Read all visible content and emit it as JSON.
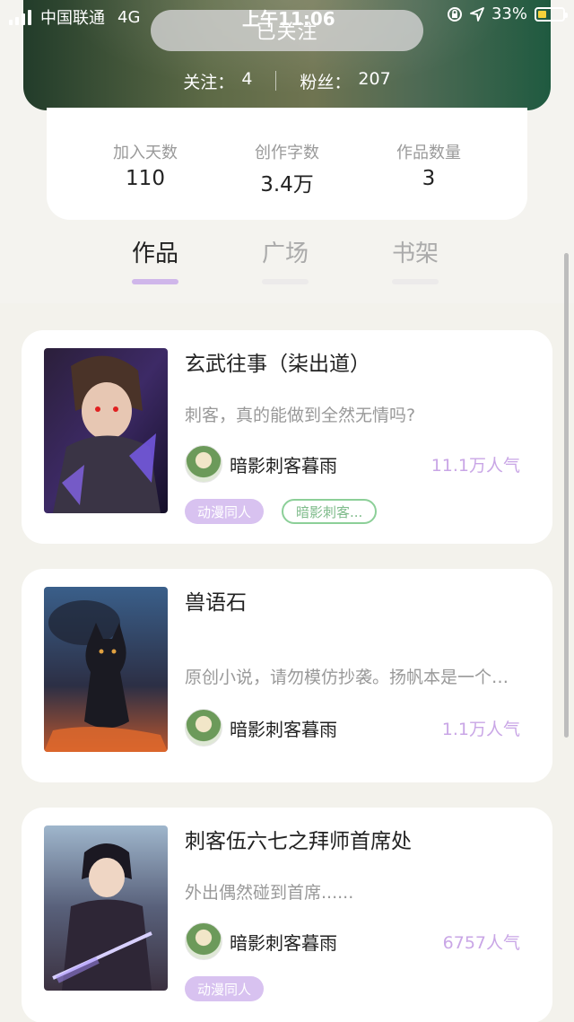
{
  "status_bar": {
    "carrier": "中国联通",
    "network": "4G",
    "time": "上午11:06",
    "battery_percent": "33%",
    "battery_level": 0.33
  },
  "header": {
    "follow_button": "已关注",
    "following_label": "关注：",
    "following_count": "4",
    "fans_label": "粉丝：",
    "fans_count": "207"
  },
  "stats": [
    {
      "label": "加入天数",
      "value": "110"
    },
    {
      "label": "创作字数",
      "value": "3.4万"
    },
    {
      "label": "作品数量",
      "value": "3"
    }
  ],
  "tabs": [
    {
      "label": "作品",
      "active": true
    },
    {
      "label": "广场",
      "active": false
    },
    {
      "label": "书架",
      "active": false
    }
  ],
  "books": [
    {
      "title": "玄武往事（柒出道）",
      "description": "刺客，真的能做到全然无情吗?",
      "author": "暗影刺客暮雨",
      "popularity": "11.1万人气",
      "tags": [
        "动漫同人",
        "暗影刺客..."
      ]
    },
    {
      "title": "兽语石",
      "description": "原创小说，请勿模仿抄袭。扬帆本是一个普通的男孩",
      "author": "暗影刺客暮雨",
      "popularity": "1.1万人气",
      "tags": []
    },
    {
      "title": "刺客伍六七之拜师首席处",
      "description": "外出偶然碰到首席......",
      "author": "暗影刺客暮雨",
      "popularity": "6757人气",
      "tags": [
        "动漫同人"
      ]
    }
  ],
  "colors": {
    "accent_purple": "#cfb6ea",
    "tag_green": "#8ccf98",
    "popularity": "#c9a6e6"
  }
}
